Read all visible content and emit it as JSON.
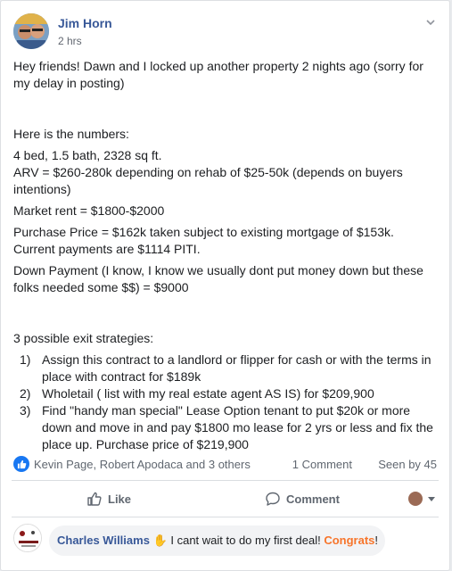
{
  "post": {
    "author": "Jim Horn",
    "time": "2 hrs",
    "paragraphs": {
      "intro": "Hey friends!  Dawn and I locked up another property 2 nights ago  (sorry for my delay in posting)",
      "numbers_heading": "Here is the numbers:",
      "line_specs": "4 bed, 1.5 bath, 2328 sq ft.",
      "line_arv": "ARV = $260-280k  depending on rehab of $25-50k (depends on buyers intentions)",
      "line_rent": "Market rent = $1800-$2000",
      "line_purchase": "Purchase Price = $162k taken subject to existing mortgage of $153k. Current payments are $1114 PITI.",
      "line_down": "Down Payment (I know, I know we usually dont put money down but these folks needed some $$) = $9000",
      "exit_heading": "3 possible exit strategies:"
    },
    "exits": [
      {
        "num": "1)",
        "text": "Assign this contract to a landlord or flipper for cash or with the terms in place with contract for $189k"
      },
      {
        "num": "2)",
        "text": "Wholetail ( list with my real estate agent AS IS) for $209,900"
      },
      {
        "num": "3)",
        "text": "Find \"handy man special\" Lease Option tenant to put $20k or more down and move in and pay $1800 mo lease for 2 yrs or less and fix the place up.  Purchase price of $219,900"
      }
    ]
  },
  "reactions": {
    "names": "Kevin Page, Robert Apodaca and 3 others",
    "comments": "1 Comment",
    "seen": "Seen by 45"
  },
  "actions": {
    "like": "Like",
    "comment": "Comment"
  },
  "comment": {
    "author": "Charles Williams",
    "text": " I cant wait to do my first deal! ",
    "highlight": "Congrats",
    "end": "!"
  },
  "colors": {
    "link": "#385898",
    "like_blue": "#1877f2",
    "highlight_orange": "#f7752b"
  }
}
